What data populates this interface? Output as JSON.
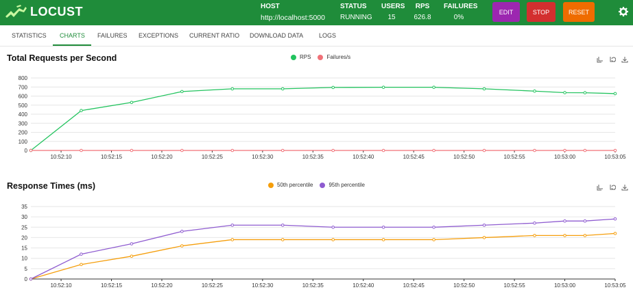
{
  "header": {
    "logo_text": "LOCUST",
    "stats": [
      {
        "label": "HOST",
        "value": "http://localhost:5000"
      },
      {
        "label": "STATUS",
        "value": "RUNNING"
      },
      {
        "label": "USERS",
        "value": "15"
      },
      {
        "label": "RPS",
        "value": "626.8"
      },
      {
        "label": "FAILURES",
        "value": "0%"
      }
    ],
    "buttons": {
      "edit": "EDIT",
      "stop": "STOP",
      "reset": "RESET"
    },
    "colors": {
      "bar": "#1f8c3a",
      "edit": "#9c27b0",
      "stop": "#d32f2f",
      "reset": "#ef6c00"
    }
  },
  "tabs": [
    {
      "label": "STATISTICS",
      "active": false
    },
    {
      "label": "CHARTS",
      "active": true
    },
    {
      "label": "FAILURES",
      "active": false
    },
    {
      "label": "EXCEPTIONS",
      "active": false
    },
    {
      "label": "CURRENT RATIO",
      "active": false
    },
    {
      "label": "DOWNLOAD DATA",
      "active": false
    },
    {
      "label": "LOGS",
      "active": false
    }
  ],
  "chart_data": [
    {
      "type": "line",
      "title": "Total Requests per Second",
      "x_tick_labels": [
        "10:52:10",
        "10:52:15",
        "10:52:20",
        "10:52:25",
        "10:52:30",
        "10:52:35",
        "10:52:40",
        "10:52:45",
        "10:52:50",
        "10:52:55",
        "10:53:00",
        "10:53:05"
      ],
      "x": [
        "10:52:07",
        "10:52:12",
        "10:52:17",
        "10:52:22",
        "10:52:27",
        "10:52:32",
        "10:52:37",
        "10:52:42",
        "10:52:47",
        "10:52:52",
        "10:52:57",
        "10:53:00",
        "10:53:02",
        "10:53:05"
      ],
      "series": [
        {
          "name": "RPS",
          "color": "#22c35e",
          "values": [
            0,
            440,
            530,
            650,
            680,
            680,
            695,
            697,
            697,
            680,
            null,
            655,
            638,
            637,
            627
          ]
        },
        {
          "name": "Failures/s",
          "color": "#f07178",
          "values": [
            0,
            0,
            0,
            0,
            0,
            0,
            0,
            0,
            0,
            0,
            null,
            0,
            0,
            0,
            0
          ]
        }
      ],
      "y_ticks": [
        0,
        100,
        200,
        300,
        400,
        500,
        600,
        700,
        800
      ],
      "ylim": [
        0,
        800
      ],
      "legend_position": "top-center"
    },
    {
      "type": "line",
      "title": "Response Times (ms)",
      "x_tick_labels": [
        "10:52:10",
        "10:52:15",
        "10:52:20",
        "10:52:25",
        "10:52:30",
        "10:52:35",
        "10:52:40",
        "10:52:45",
        "10:52:50",
        "10:52:55",
        "10:53:00",
        "10:53:05"
      ],
      "series": [
        {
          "name": "50th percentile",
          "color": "#f59e0b",
          "values": [
            0,
            7,
            11,
            16,
            19,
            19,
            19,
            19,
            19,
            20,
            21,
            21,
            21,
            22
          ]
        },
        {
          "name": "95th percentile",
          "color": "#8e5bd0",
          "values": [
            0,
            12,
            17,
            23,
            26,
            26,
            25,
            25,
            25,
            26,
            27,
            28,
            28,
            29
          ]
        }
      ],
      "y_ticks": [
        0,
        5,
        10,
        15,
        20,
        25,
        30,
        35
      ],
      "ylim": [
        0,
        35
      ],
      "legend_position": "top-center"
    }
  ]
}
